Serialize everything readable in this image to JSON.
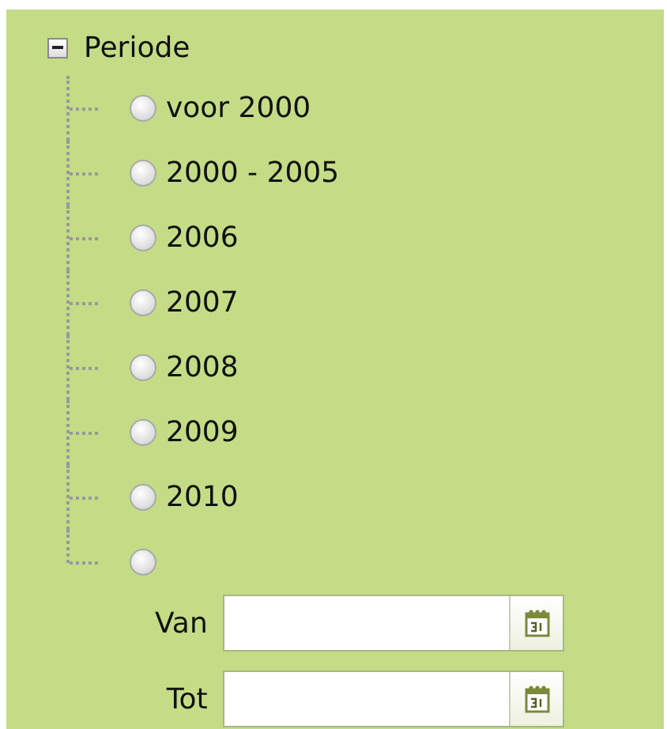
{
  "group": {
    "title": "Periode",
    "expanded": true,
    "options": [
      {
        "kind": "option",
        "label": "voor 2000",
        "selected": false
      },
      {
        "kind": "option",
        "label": "2000 - 2005",
        "selected": false
      },
      {
        "kind": "option",
        "label": "2006",
        "selected": false
      },
      {
        "kind": "option",
        "label": "2007",
        "selected": false
      },
      {
        "kind": "option",
        "label": "2008",
        "selected": false
      },
      {
        "kind": "option",
        "label": "2009",
        "selected": false
      },
      {
        "kind": "option",
        "label": "2010",
        "selected": false
      },
      {
        "kind": "range",
        "selected": false,
        "fields": [
          {
            "label": "Van"
          },
          {
            "label": "Tot"
          }
        ]
      }
    ]
  }
}
